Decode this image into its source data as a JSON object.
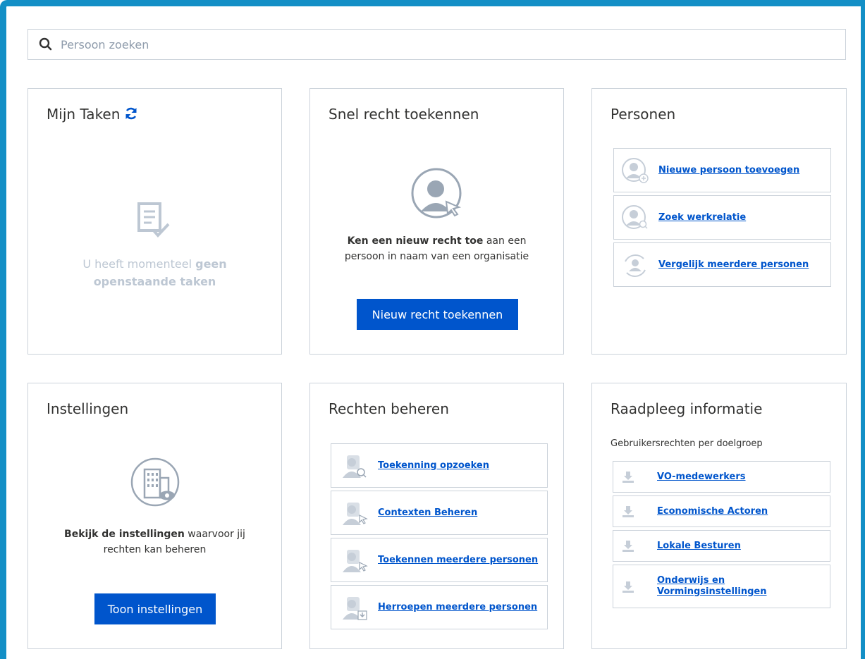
{
  "search": {
    "placeholder": "Persoon zoeken"
  },
  "tasks": {
    "title": "Mijn Taken",
    "empty_prefix": "U heeft momenteel ",
    "empty_bold_1": "geen",
    "empty_bold_2": "openstaande taken"
  },
  "quick_grant": {
    "title": "Snel recht toekennen",
    "desc_bold": "Ken een nieuw recht toe",
    "desc_rest_1": " aan een",
    "desc_rest_2": "persoon in naam van een organisatie",
    "button": "Nieuw recht toekennen"
  },
  "persons": {
    "title": "Personen",
    "items": [
      {
        "label": "Nieuwe persoon toevoegen",
        "icon": "person-add-icon"
      },
      {
        "label": "Zoek werkrelatie",
        "icon": "person-search-icon"
      },
      {
        "label": "Vergelijk meerdere personen",
        "icon": "person-compare-icon"
      }
    ]
  },
  "settings": {
    "title": "Instellingen",
    "desc_bold": "Bekijk de instellingen",
    "desc_rest_1": " waarvoor jij",
    "desc_rest_2": "rechten kan beheren",
    "button": "Toon instellingen"
  },
  "rights": {
    "title": "Rechten beheren",
    "items": [
      {
        "label": "Toekenning opzoeken",
        "icon": "person-search-icon"
      },
      {
        "label": "Contexten Beheren",
        "icon": "person-cursor-icon"
      },
      {
        "label": "Toekennen meerdere personen",
        "icon": "person-cursor-icon"
      },
      {
        "label": "Herroepen meerdere personen",
        "icon": "person-download-icon"
      }
    ]
  },
  "info": {
    "title": "Raadpleeg informatie",
    "subtitle": "Gebruikersrechten per doelgroep",
    "items": [
      {
        "label": "VO-medewerkers",
        "icon": "download-icon"
      },
      {
        "label": "Economische Actoren",
        "icon": "download-icon"
      },
      {
        "label": "Lokale Besturen",
        "icon": "download-icon"
      },
      {
        "label_line1": "Onderwijs en",
        "label_line2": "Vormingsinstellingen",
        "icon": "download-icon"
      }
    ]
  },
  "colors": {
    "accent": "#0055cc",
    "frame": "#138fc6",
    "border": "#cbd2da",
    "muted": "#bdc7d3"
  }
}
